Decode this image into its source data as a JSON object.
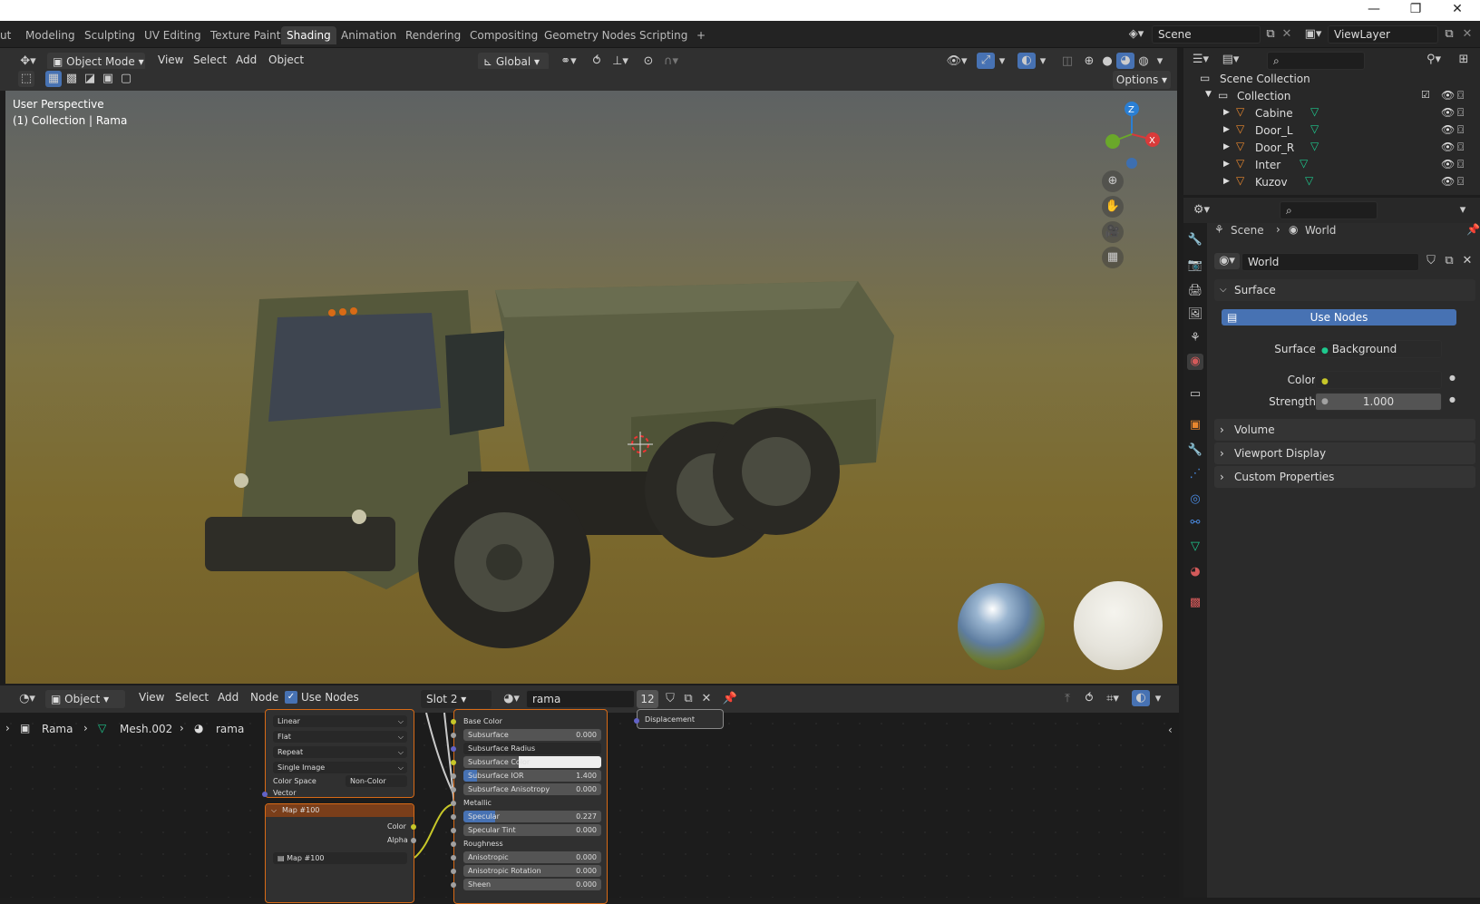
{
  "window_controls": {
    "minimize": "—",
    "maximize": "❐",
    "close": "✕"
  },
  "workspace_tabs": [
    {
      "label": "ut"
    },
    {
      "label": "Modeling"
    },
    {
      "label": "Sculpting"
    },
    {
      "label": "UV Editing"
    },
    {
      "label": "Texture Paint"
    },
    {
      "label": "Shading"
    },
    {
      "label": "Animation"
    },
    {
      "label": "Rendering"
    },
    {
      "label": "Compositing"
    },
    {
      "label": "Geometry Nodes"
    },
    {
      "label": "Scripting"
    },
    {
      "label": "+"
    }
  ],
  "active_tab": "Shading",
  "scene": {
    "name": "Scene",
    "view_layer": "ViewLayer"
  },
  "viewport_header": {
    "mode": "Object Mode",
    "menus": [
      "View",
      "Select",
      "Add",
      "Object"
    ],
    "transform": "Global",
    "options": "Options"
  },
  "viewport": {
    "perspective": "User Perspective",
    "collection_info": "(1) Collection | Rama",
    "gizmo": {
      "z": "Z",
      "x": "X"
    }
  },
  "outliner": {
    "root": "Scene Collection",
    "collection": "Collection",
    "items": [
      {
        "name": "Cabine"
      },
      {
        "name": "Door_L"
      },
      {
        "name": "Door_R"
      },
      {
        "name": "Inter"
      },
      {
        "name": "Kuzov"
      }
    ]
  },
  "properties": {
    "breadcrumb": {
      "scene": "Scene",
      "world": "World"
    },
    "world_name": "World",
    "surface_panel": "Surface",
    "use_nodes": "Use Nodes",
    "surface_label": "Surface",
    "surface_value": "Background",
    "color_label": "Color",
    "strength_label": "Strength",
    "strength_value": "1.000",
    "collapsed_panels": [
      {
        "label": "Volume"
      },
      {
        "label": "Viewport Display"
      },
      {
        "label": "Custom Properties"
      }
    ]
  },
  "node_header": {
    "editor": "Object",
    "menus": [
      "View",
      "Select",
      "Add",
      "Node"
    ],
    "use_nodes": "Use Nodes",
    "slot": "Slot 2",
    "material": "rama",
    "users": "12"
  },
  "node_breadcrumb": {
    "object": "Rama",
    "mesh": "Mesh.002",
    "material": "rama"
  },
  "image_node": {
    "interp": "Linear",
    "projection": "Flat",
    "extension": "Repeat",
    "source": "Single Image",
    "color_space_label": "Color Space",
    "color_space": "Non-Color",
    "vector": "Vector"
  },
  "map_node": {
    "title": "Map #100",
    "color": "Color",
    "alpha": "Alpha",
    "image": "Map #100"
  },
  "bsdf_node": {
    "rows": [
      {
        "label": "Base Color",
        "value": ""
      },
      {
        "label": "Subsurface",
        "value": "0.000"
      },
      {
        "label": "Subsurface Radius",
        "value": ""
      },
      {
        "label": "Subsurface Color",
        "value": ""
      },
      {
        "label": "Subsurface IOR",
        "value": "1.400"
      },
      {
        "label": "Subsurface Anisotropy",
        "value": "0.000"
      },
      {
        "label": "Metallic",
        "value": ""
      },
      {
        "label": "Specular",
        "value": "0.227"
      },
      {
        "label": "Specular Tint",
        "value": "0.000"
      },
      {
        "label": "Roughness",
        "value": ""
      },
      {
        "label": "Anisotropic",
        "value": "0.000"
      },
      {
        "label": "Anisotropic Rotation",
        "value": "0.000"
      },
      {
        "label": "Sheen",
        "value": "0.000"
      }
    ]
  },
  "output_node": {
    "displacement": "Displacement"
  },
  "colors": {
    "accent": "#4772b3",
    "node_border": "#d86a16",
    "socket_yellow": "#c7c729",
    "socket_grey": "#a1a1a1",
    "socket_blue": "#6363c7",
    "mesh_green": "#1ec98e"
  }
}
